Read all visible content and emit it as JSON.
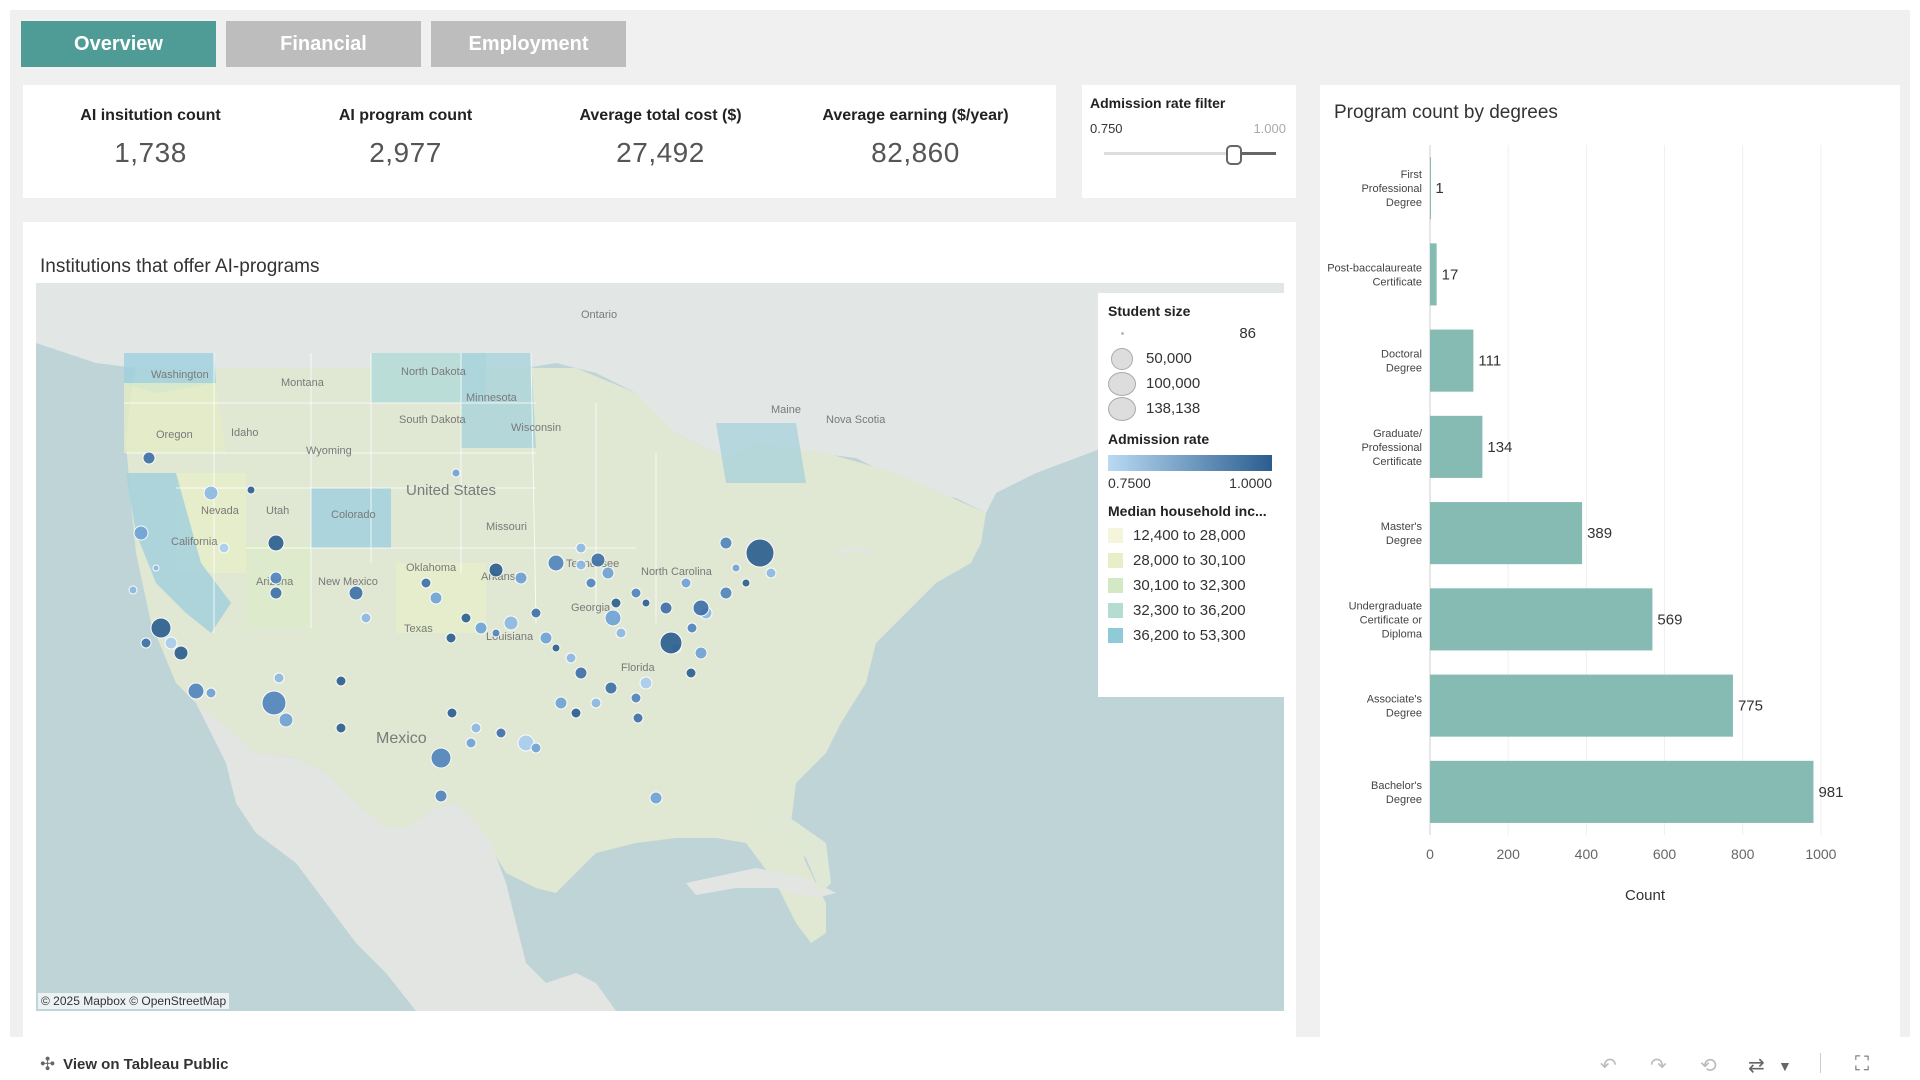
{
  "tabs": [
    {
      "label": "Overview",
      "active": true
    },
    {
      "label": "Financial",
      "active": false
    },
    {
      "label": "Employment",
      "active": false
    }
  ],
  "kpis": [
    {
      "label": "AI insitution count",
      "value": "1,738"
    },
    {
      "label": "AI program count",
      "value": "2,977"
    },
    {
      "label": "Average total cost ($)",
      "value": "27,492"
    },
    {
      "label": "Average earning ($/year)",
      "value": "82,860"
    }
  ],
  "filter": {
    "title": "Admission rate filter",
    "min_label": "0.750",
    "max_label": "1.000",
    "range": [
      0.75,
      1.0
    ]
  },
  "map": {
    "title": "Institutions that offer AI-programs",
    "attribution": "© 2025 Mapbox  © OpenStreetMap",
    "place_labels": [
      "Ontario",
      "Washington",
      "Montana",
      "North Dakota",
      "Minnesota",
      "Oregon",
      "Idaho",
      "South Dakota",
      "Wyoming",
      "Nevada",
      "Utah",
      "Colorado",
      "United States",
      "Missouri",
      "Arizona",
      "New Mexico",
      "Oklahoma",
      "Texas",
      "Arkansas",
      "Tennessee",
      "Mexico",
      "Maine",
      "Nova Scotia",
      "California",
      "Florida",
      "North Carolina",
      "Georgia",
      "Louisiana",
      "Wisconsin"
    ],
    "legend": {
      "size_title": "Student size",
      "sizes": [
        "86",
        "50,000",
        "100,000",
        "138,138"
      ],
      "rate_title": "Admission rate",
      "rate_min": "0.7500",
      "rate_max": "1.0000",
      "income_title": "Median household inc...",
      "income_bins": [
        {
          "label": "12,400 to 28,000",
          "color": "#f4f5dc"
        },
        {
          "label": "28,000 to 30,100",
          "color": "#e7efc9"
        },
        {
          "label": "30,100 to 32,300",
          "color": "#d3e8c4"
        },
        {
          "label": "32,300 to 36,200",
          "color": "#b4dcd0"
        },
        {
          "label": "36,200 to 53,300",
          "color": "#8ecbd6"
        }
      ]
    }
  },
  "chart_data": {
    "type": "bar",
    "title": "Program count by degrees",
    "xlabel": "Count",
    "ylabel": "",
    "categories": [
      "First Professional Degree",
      "Post-baccalaureate Certificate",
      "Doctoral Degree",
      "Graduate/ Professional Certificate",
      "Master's Degree",
      "Undergraduate Certificate or Diploma",
      "Associate's Degree",
      "Bachelor's Degree"
    ],
    "values": [
      1,
      17,
      111,
      134,
      389,
      569,
      775,
      981
    ],
    "xlim": [
      0,
      1100
    ],
    "xticks": [
      0,
      200,
      400,
      600,
      800,
      1000
    ],
    "grid": true,
    "color": "#86bbb3"
  },
  "footer": {
    "view_label": "View on Tableau Public"
  }
}
